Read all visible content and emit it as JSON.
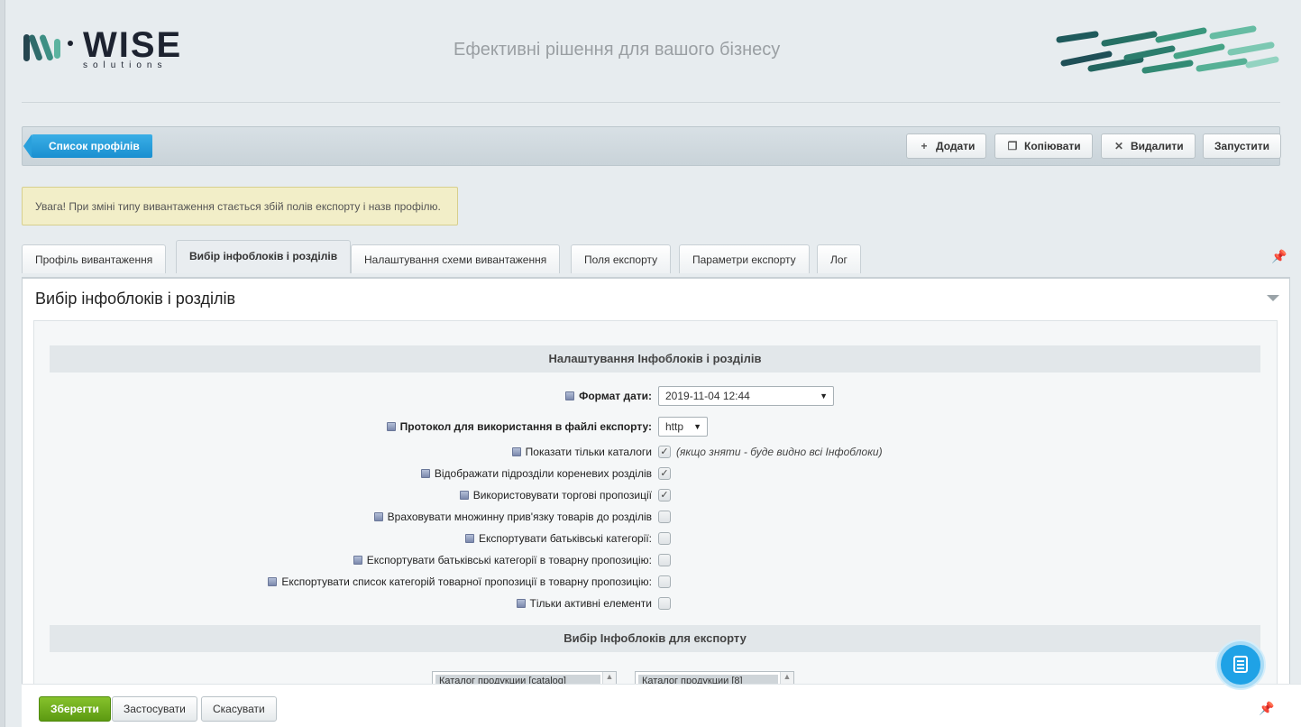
{
  "header": {
    "logo_word": "WISE",
    "logo_sub": "solutions",
    "tagline": "Ефективні рішення для вашого бізнесу"
  },
  "toolbar": {
    "profiles_label": "Список профілів",
    "add_label": "Додати",
    "copy_label": "Копіювати",
    "delete_label": "Видалити",
    "run_label": "Запустити"
  },
  "warning": "Увага! При зміні типу вивантаження стається збій полів експорту і назв профілю.",
  "tabs": [
    {
      "label": "Профіль вивантаження",
      "active": false
    },
    {
      "label": "Вибір інфоблоків і розділів",
      "active": true
    },
    {
      "label": "Налаштування схеми вивантаження",
      "active": false
    },
    {
      "label": "Поля експорту",
      "active": false
    },
    {
      "label": "Параметри експорту",
      "active": false
    },
    {
      "label": "Лог",
      "active": false
    }
  ],
  "panel": {
    "title": "Вибір інфоблоків і розділів",
    "section1": "Налаштування Інфоблоків і розділів",
    "section2": "Вибір Інфоблоків для експорту",
    "date_format": {
      "label": "Формат дати:",
      "value": "2019-11-04 12:44"
    },
    "protocol": {
      "label": "Протокол для використання в файлі експорту:",
      "value": "http"
    },
    "checkboxes": [
      {
        "label": "Показати тільки каталоги",
        "checked": true,
        "note": "(якщо зняти - буде видно всі Інфоблоки)"
      },
      {
        "label": "Відображати підрозділи кореневих розділів",
        "checked": true
      },
      {
        "label": "Використовувати торгові пропозиції",
        "checked": true
      },
      {
        "label": "Враховувати множинну прив'язку товарів до розділів",
        "checked": false
      },
      {
        "label": "Експортувати батьківські категорії:",
        "checked": false
      },
      {
        "label": "Експортувати батьківські категорії в товарну пропозицію:",
        "checked": false
      },
      {
        "label": "Експортувати список категорій товарної пропозиції в товарну пропозицію:",
        "checked": false
      },
      {
        "label": "Тільки активні елементи",
        "checked": false
      }
    ],
    "listbox1_option": "Каталог продукции [catalog]",
    "listbox2_option": "Каталог продукции [8]"
  },
  "bottom": {
    "save_label": "Зберегти",
    "apply_label": "Застосувати",
    "cancel_label": "Скасувати"
  },
  "colors": {
    "accent_blue": "#1a8fd0",
    "save_green": "#6aa81c",
    "warning_bg": "#f2eec8",
    "chat_blue": "#1fa2e6"
  }
}
